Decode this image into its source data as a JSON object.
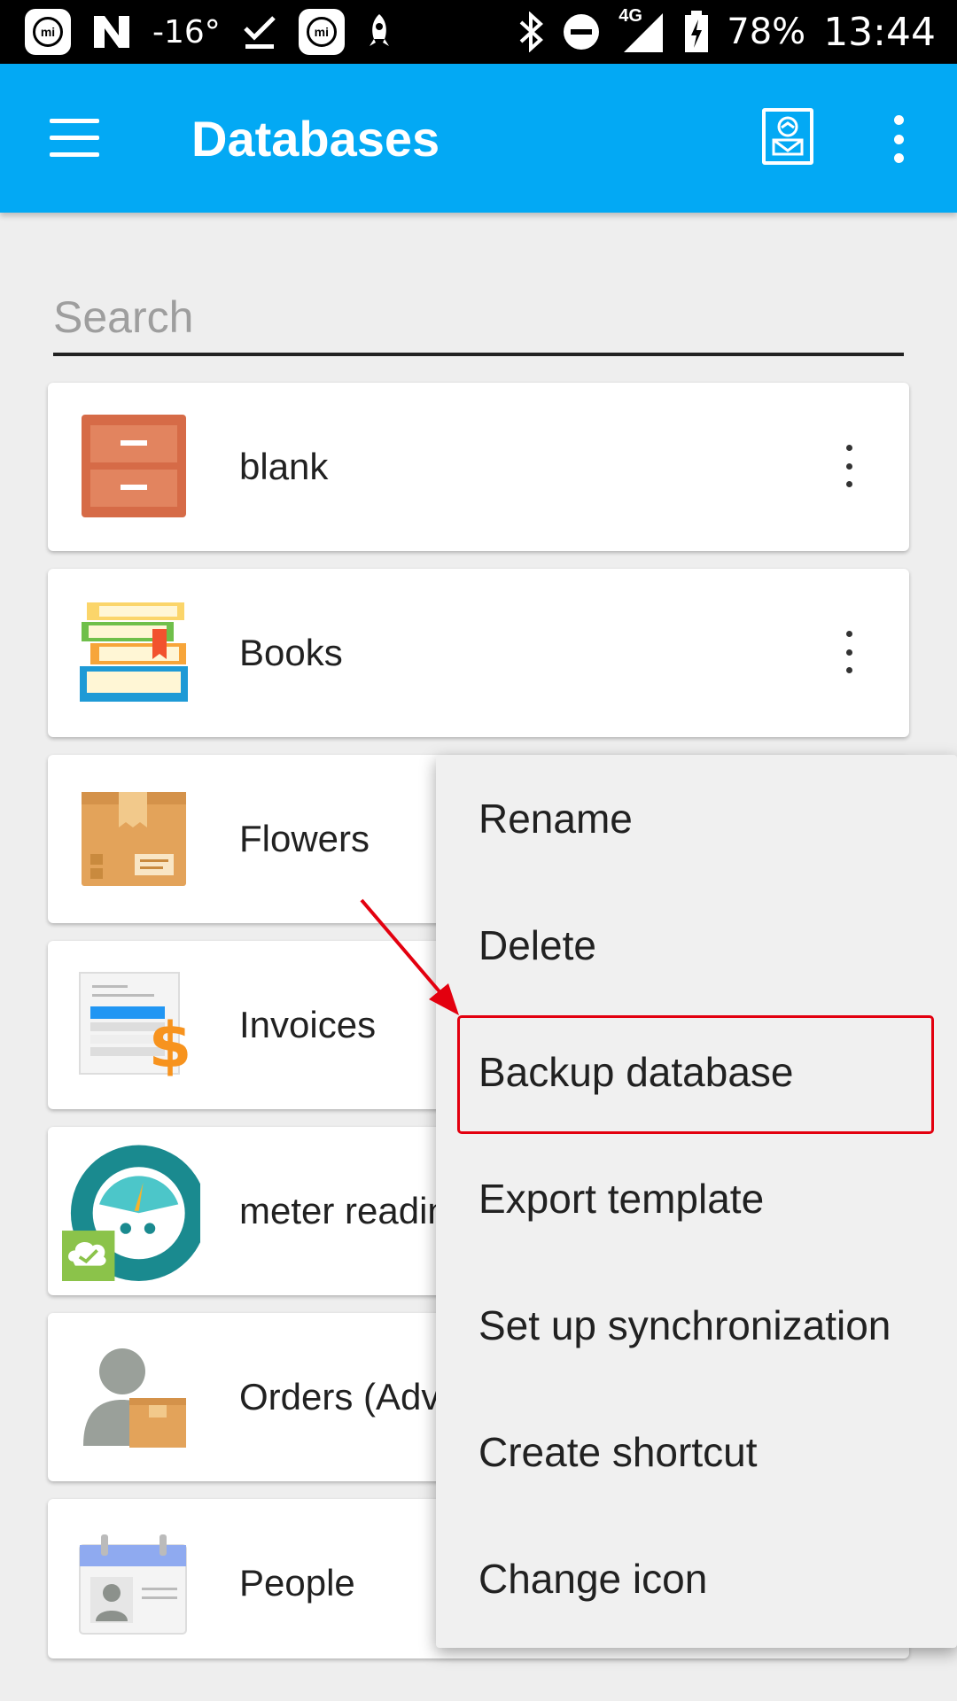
{
  "status_bar": {
    "temperature": "-16°",
    "network": "4G",
    "battery": "78%",
    "time": "13:44"
  },
  "app_bar": {
    "title": "Databases",
    "menu_icon": "hamburger-menu-icon",
    "backup_icon": "backup-device-icon",
    "more_icon": "more-vert-icon"
  },
  "search": {
    "placeholder": "Search",
    "value": ""
  },
  "databases": [
    {
      "label": "blank",
      "icon": "cabinet-icon"
    },
    {
      "label": "Books",
      "icon": "books-icon"
    },
    {
      "label": "Flowers",
      "icon": "box-icon"
    },
    {
      "label": "Invoices",
      "icon": "invoice-icon"
    },
    {
      "label": "meter readin",
      "icon": "meter-icon"
    },
    {
      "label": "Orders (Adv",
      "icon": "orders-icon"
    },
    {
      "label": "People",
      "icon": "contact-card-icon"
    }
  ],
  "context_menu": {
    "items": [
      "Rename",
      "Delete",
      "Backup database",
      "Export template",
      "Set up synchronization",
      "Create shortcut",
      "Change icon"
    ],
    "highlighted": "Backup database"
  },
  "colors": {
    "app_bar": "#03a9f4",
    "highlight": "#e3000f"
  }
}
